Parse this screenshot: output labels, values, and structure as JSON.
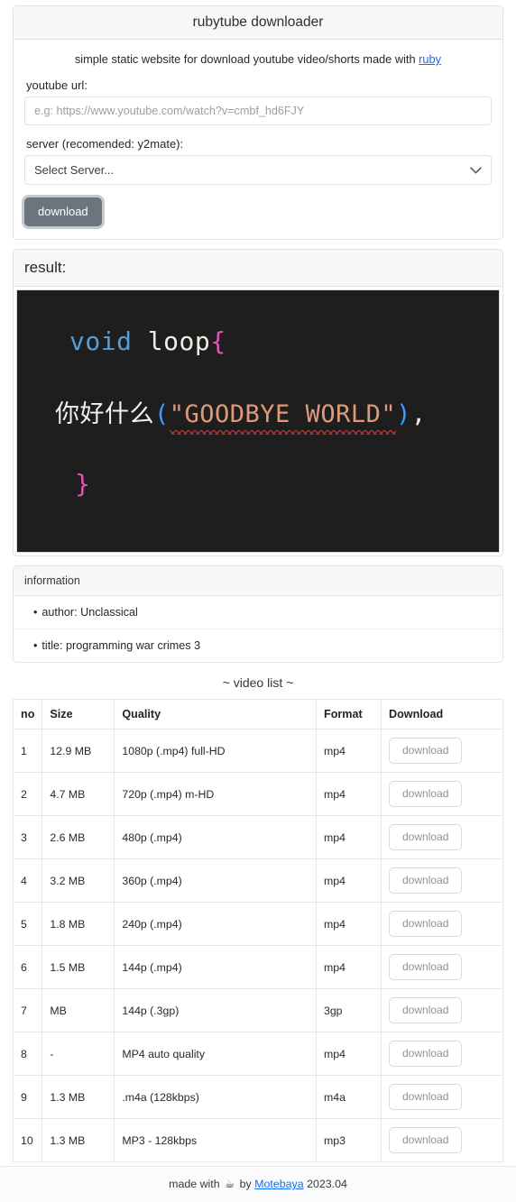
{
  "header": {
    "title": "rubytube downloader"
  },
  "form": {
    "lead_prefix": "simple static website for download youtube video/shorts made with ",
    "lead_link": "ruby",
    "url_label": "youtube url:",
    "url_value": "",
    "url_placeholder": "e.g: https://www.youtube.com/watch?v=cmbf_hd6FJY",
    "server_label": "server (recomended: y2mate):",
    "server_selected": "Select Server...",
    "server_options": [
      "Select Server..."
    ],
    "chevron_icon": "chevron-down-icon",
    "download_button": "download"
  },
  "result": {
    "header": "result:",
    "thumbnail": {
      "background_color": "#1e1e1e",
      "line1": [
        {
          "text": "void",
          "color": "#569cd6"
        },
        {
          "text": " loop",
          "color": "#f0eee4"
        },
        {
          "text": "{",
          "color": "#e056b0"
        }
      ],
      "line2": [
        {
          "text": "你好什么",
          "color": "#f2f2f2"
        },
        {
          "text": "(",
          "color": "#3b9eff"
        },
        {
          "text": "\"GOODBYE WORLD\"",
          "color": "#e09a7a"
        },
        {
          "text": ")",
          "color": "#3b9eff"
        },
        {
          "text": ",",
          "color": "#f0eee4"
        }
      ],
      "line3": [
        {
          "text": "}",
          "color": "#e056b0"
        }
      ]
    }
  },
  "information": {
    "header": "information",
    "items": [
      {
        "bullet": "•",
        "text": "author: Unclassical"
      },
      {
        "bullet": "•",
        "text": "title: programming war crimes 3"
      }
    ]
  },
  "video_list": {
    "title": "~ video list ~",
    "columns": [
      "no",
      "Size",
      "Quality",
      "Format",
      "Download"
    ],
    "download_label": "download",
    "rows": [
      {
        "no": "1",
        "size": "12.9 MB",
        "quality": "1080p (.mp4) full-HD",
        "format": "mp4",
        "download": "download"
      },
      {
        "no": "2",
        "size": "4.7 MB",
        "quality": "720p (.mp4) m-HD",
        "format": "mp4",
        "download": "download"
      },
      {
        "no": "3",
        "size": "2.6 MB",
        "quality": "480p (.mp4)",
        "format": "mp4",
        "download": "download"
      },
      {
        "no": "4",
        "size": "3.2 MB",
        "quality": "360p (.mp4)",
        "format": "mp4",
        "download": "download"
      },
      {
        "no": "5",
        "size": "1.8 MB",
        "quality": "240p (.mp4)",
        "format": "mp4",
        "download": "download"
      },
      {
        "no": "6",
        "size": "1.5 MB",
        "quality": "144p (.mp4)",
        "format": "mp4",
        "download": "download"
      },
      {
        "no": "7",
        "size": "MB",
        "quality": "144p (.3gp)",
        "format": "3gp",
        "download": "download"
      },
      {
        "no": "8",
        "size": "-",
        "quality": "MP4 auto quality",
        "format": "mp4",
        "download": "download"
      },
      {
        "no": "9",
        "size": "1.3 MB",
        "quality": ".m4a (128kbps)",
        "format": "m4a",
        "download": "download"
      },
      {
        "no": "10",
        "size": "1.3 MB",
        "quality": "MP3 - 128kbps",
        "format": "mp3",
        "download": "download"
      }
    ]
  },
  "footer": {
    "made_with": "made with",
    "coffee_icon": "☕",
    "by": "by",
    "author": "Motebaya",
    "year": "2023.04"
  },
  "colors": {
    "accent_link": "#0d6efd",
    "button_secondary": "#6c757d",
    "card_border": "#dee2e6",
    "header_bg": "#f7f7f8"
  }
}
